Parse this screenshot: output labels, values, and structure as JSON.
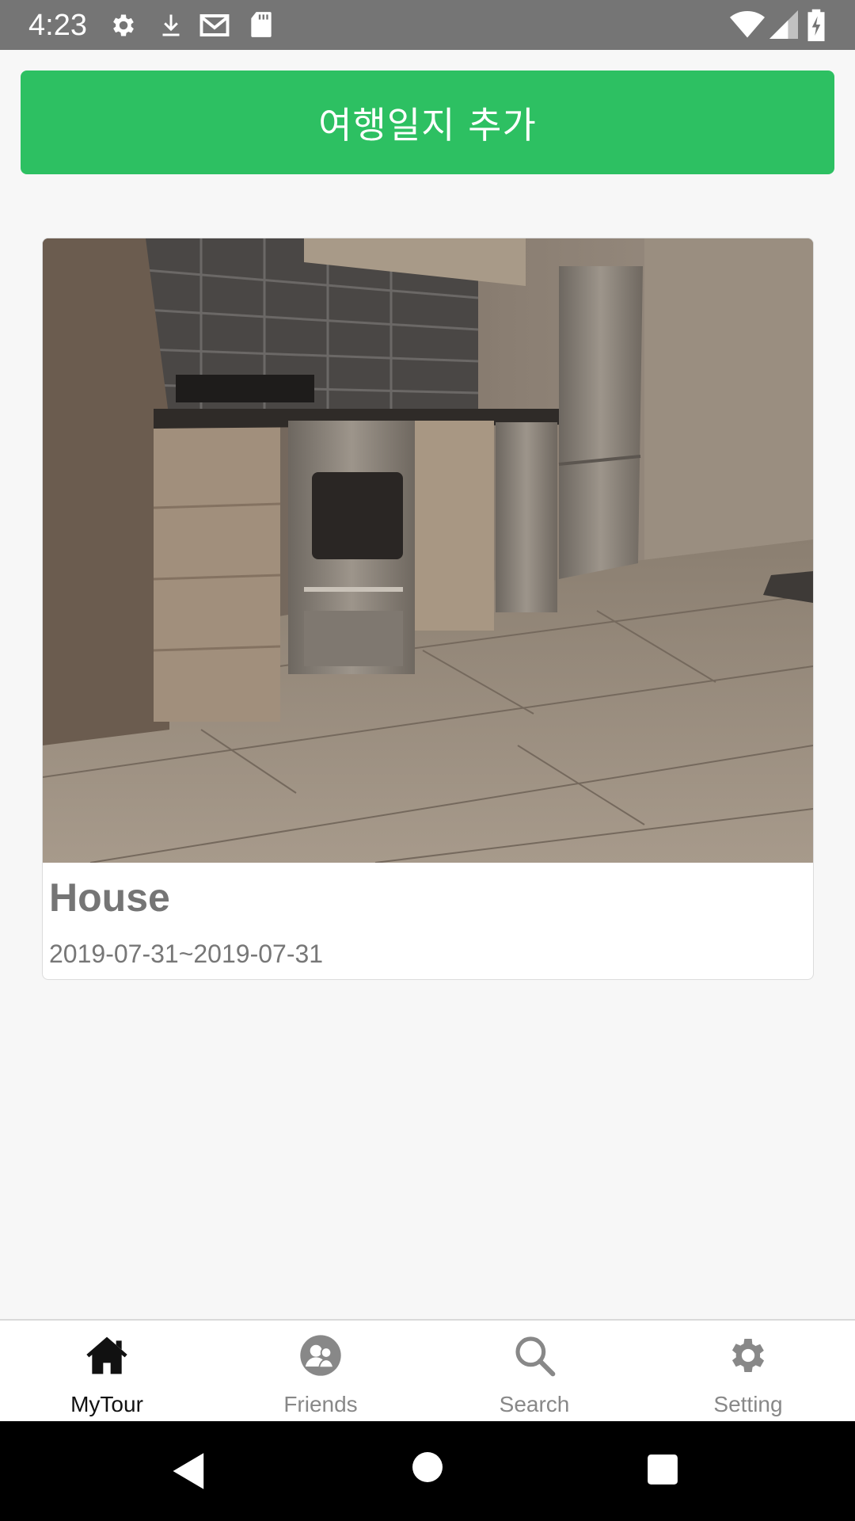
{
  "status_bar": {
    "time": "4:23",
    "left_icons": [
      "gear-icon",
      "download-icon",
      "gmail-icon",
      "sd-card-icon"
    ],
    "right_icons": [
      "wifi-icon",
      "signal-icon",
      "battery-charging-icon"
    ]
  },
  "add_button": {
    "label": "여행일지 추가",
    "color": "#2dc062"
  },
  "journal": {
    "title": "House",
    "date_range": "2019-07-31~2019-07-31",
    "image": "kitchen-photo"
  },
  "bottom_nav": {
    "items": [
      {
        "label": "MyTour",
        "icon": "home-icon",
        "active": true
      },
      {
        "label": "Friends",
        "icon": "friends-icon",
        "active": false
      },
      {
        "label": "Search",
        "icon": "search-icon",
        "active": false
      },
      {
        "label": "Setting",
        "icon": "gear-icon",
        "active": false
      }
    ]
  },
  "system_nav": [
    "back-icon",
    "home-circle-icon",
    "recents-icon"
  ]
}
